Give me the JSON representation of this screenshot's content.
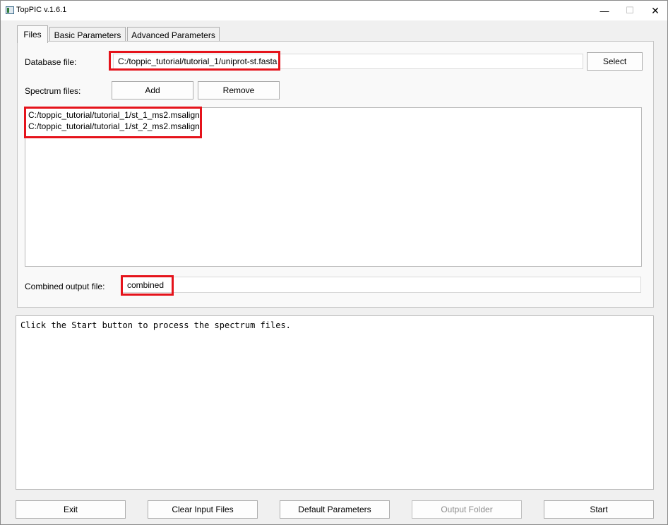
{
  "window": {
    "title": "TopPIC v.1.6.1",
    "controls": {
      "minimize": "—",
      "maximize": "☐",
      "close": "✕"
    }
  },
  "tabs": [
    {
      "label": "Files",
      "active": true
    },
    {
      "label": "Basic Parameters",
      "active": false
    },
    {
      "label": "Advanced Parameters",
      "active": false
    }
  ],
  "files_tab": {
    "database_label": "Database file:",
    "database_value": "C:/toppic_tutorial/tutorial_1/uniprot-st.fasta",
    "select_button": "Select",
    "spectrum_label": "Spectrum files:",
    "add_button": "Add",
    "remove_button": "Remove",
    "spectrum_files": [
      "C:/toppic_tutorial/tutorial_1/st_1_ms2.msalign",
      "C:/toppic_tutorial/tutorial_1/st_2_ms2.msalign"
    ],
    "combined_label": "Combined output file:",
    "combined_value": "combined"
  },
  "log": {
    "text": "Click the Start button to process the spectrum files."
  },
  "bottom_buttons": {
    "exit": "Exit",
    "clear_input": "Clear Input Files",
    "default_params": "Default Parameters",
    "output_folder": "Output Folder",
    "start": "Start"
  },
  "colors": {
    "highlight": "#e5131b",
    "window_bg": "#f0f0f0"
  }
}
